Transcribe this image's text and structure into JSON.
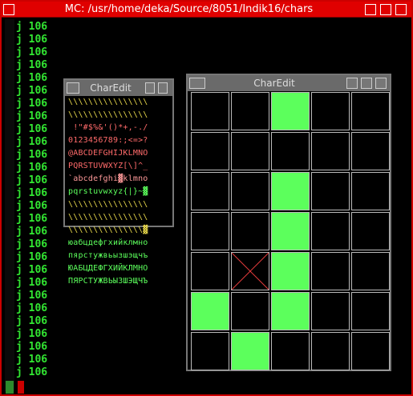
{
  "terminal": {
    "title": "MC: /usr/home/deka/Source/8051/Indik16/chars",
    "lines": [
      "j 106",
      "j 106",
      "j 106",
      "j 106",
      "j 106",
      "j 106",
      "j 106",
      "j 106",
      "j 106",
      "j 106",
      "j 106",
      "j 106",
      "j 106",
      "j 106",
      "j 106",
      "j 106",
      "j 106",
      "j 106",
      "j 106",
      "j 106",
      "j 106",
      "j 106",
      "j 106",
      "j 106",
      "j 106",
      "j 106",
      "j 106",
      "j 106"
    ]
  },
  "small_charedit": {
    "title": "CharEdit",
    "rows": [
      {
        "text": "\\\\\\\\\\\\\\\\\\\\\\\\\\\\\\\\",
        "color": "#e8d84a"
      },
      {
        "text": "\\\\\\\\\\\\\\\\\\\\\\\\\\\\\\\\",
        "color": "#e8d84a"
      },
      {
        "text": " !\"#$%&'()*+,-./",
        "color": "#ff6a6a"
      },
      {
        "text": "0123456789:;<=>?",
        "color": "#ff6a6a"
      },
      {
        "text": "@ABCDEFGHIJKLMNO",
        "color": "#ff6a6a"
      },
      {
        "text": "PQRSTUVWXYZ[\\]^_",
        "color": "#ff6a6a"
      },
      {
        "text": "`abcdefghi▓klmno",
        "color": "#ff9a9a"
      },
      {
        "text": "pqrstuvwxyz{|}~▓",
        "color": "#5cff5c"
      },
      {
        "text": "\\\\\\\\\\\\\\\\\\\\\\\\\\\\\\\\",
        "color": "#e8d84a"
      },
      {
        "text": "\\\\\\\\\\\\\\\\\\\\\\\\\\\\\\\\",
        "color": "#e8d84a"
      },
      {
        "text": "\\\\\\\\\\\\\\\\\\\\\\\\\\\\\\▓",
        "color": "#e8d84a"
      },
      {
        "text": "юабцдефгхийклмно",
        "color": "#5cff5c"
      },
      {
        "text": "пярстужвьызшэщчъ",
        "color": "#5cff5c"
      },
      {
        "text": "ЮАБЦДЕФГХИЙКЛМНО",
        "color": "#5cff5c"
      },
      {
        "text": "ПЯРСТУЖВЬЫЗШЭЩЧЪ",
        "color": "#5cff5c"
      }
    ]
  },
  "big_charedit": {
    "title": "CharEdit",
    "pixels": [
      [
        0,
        0,
        1,
        0,
        0
      ],
      [
        0,
        0,
        0,
        0,
        0
      ],
      [
        0,
        0,
        1,
        0,
        0
      ],
      [
        0,
        0,
        1,
        0,
        0
      ],
      [
        0,
        0,
        1,
        0,
        0
      ],
      [
        1,
        0,
        1,
        0,
        0
      ],
      [
        0,
        1,
        0,
        0,
        0
      ]
    ],
    "cursor": [
      4,
      1
    ],
    "on_color": "#5cff5c",
    "cursor_color": "#e23b3b"
  }
}
